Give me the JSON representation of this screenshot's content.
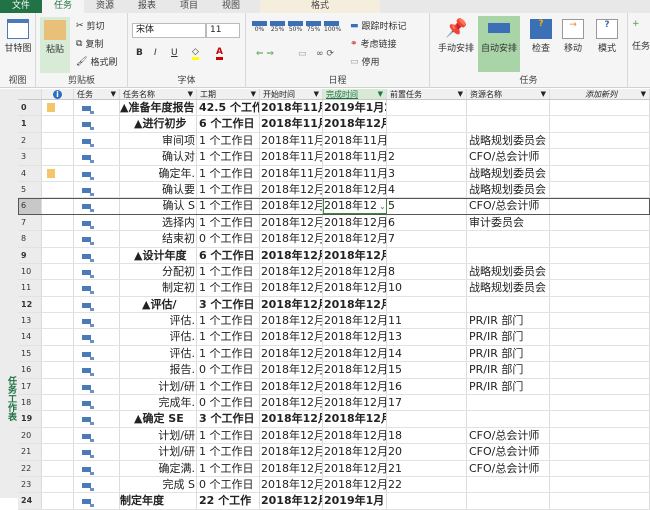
{
  "tabs": [
    "文件",
    "任务",
    "资源",
    "报表",
    "项目",
    "视图",
    "格式"
  ],
  "ribbon": {
    "view_group": {
      "gantt": "甘特图",
      "label": "视图"
    },
    "clipboard": {
      "paste": "粘贴",
      "cut": "剪切",
      "copy": "复制",
      "format_painter": "格式刷",
      "label": "剪贴板"
    },
    "font": {
      "name": "宋体",
      "size": "11",
      "bold": "B",
      "italic": "I",
      "underline": "U",
      "label": "字体"
    },
    "schedule": {
      "pcts": [
        "0%",
        "25%",
        "50%",
        "75%",
        "100%"
      ],
      "mark_on_track": "跟踪时标记",
      "respect_links": "考虑链接",
      "inactivate": "停用",
      "label": "日程"
    },
    "tasks": {
      "manual": "手动安排",
      "auto": "自动安排",
      "inspect": "检查",
      "move": "移动",
      "mode": "模式",
      "task": "任务",
      "label": "任务"
    }
  },
  "sidebar_label": "任务工作表",
  "columns": [
    "任务",
    "任务名称",
    "工期",
    "开始时间",
    "完成时间",
    "前置任务",
    "资源名称",
    "添加新列"
  ],
  "rows": [
    {
      "id": "0",
      "note": true,
      "name": "▲准备年度报告",
      "summary": true,
      "lvl": 0,
      "dur": "42.5 个工作",
      "start": "2018年11月",
      "finish": "2019年1月2",
      "pred": "",
      "res": ""
    },
    {
      "id": "1",
      "name": "▲进行初步",
      "summary": true,
      "lvl": 1,
      "dur": "6 个工作日",
      "start": "2018年11月",
      "finish": "2018年12月",
      "pred": "",
      "res": ""
    },
    {
      "id": "2",
      "name": "审间项",
      "dur": "1 个工作日",
      "start": "2018年11月",
      "finish": "2018年11月",
      "pred": "",
      "res": "战略规划委员会"
    },
    {
      "id": "3",
      "name": "确认对",
      "dur": "1 个工作日",
      "start": "2018年11月",
      "finish": "2018年11月",
      "pred": "2",
      "res": "CFO/总会计师"
    },
    {
      "id": "4",
      "note": true,
      "name": "确定年.",
      "dur": "1 个工作日",
      "start": "2018年11月",
      "finish": "2018年11月",
      "pred": "3",
      "res": "战略规划委员会"
    },
    {
      "id": "5",
      "name": "确认要",
      "dur": "1 个工作日",
      "start": "2018年12月",
      "finish": "2018年12月",
      "pred": "4",
      "res": "战略规划委员会"
    },
    {
      "id": "6",
      "name": "确认 S",
      "dur": "1 个工作日",
      "start": "2018年12月",
      "finish": "2018年12",
      "pred": "5",
      "res": "CFO/总会计师",
      "selected": true
    },
    {
      "id": "7",
      "name": "选择内",
      "dur": "1 个工作日",
      "start": "2018年12月",
      "finish": "2018年12月",
      "pred": "6",
      "res": "审计委员会"
    },
    {
      "id": "8",
      "name": "结束初",
      "dur": "0 个工作日",
      "start": "2018年12月",
      "finish": "2018年12月",
      "pred": "7",
      "res": ""
    },
    {
      "id": "9",
      "name": "▲设计年度",
      "summary": true,
      "lvl": 1,
      "dur": "6 个工作日",
      "start": "2018年12月",
      "finish": "2018年12月",
      "pred": "",
      "res": ""
    },
    {
      "id": "10",
      "name": "分配初",
      "dur": "1 个工作日",
      "start": "2018年12月",
      "finish": "2018年12月",
      "pred": "8",
      "res": "战略规划委员会"
    },
    {
      "id": "11",
      "name": "制定初",
      "dur": "1 个工作日",
      "start": "2018年12月",
      "finish": "2018年12月",
      "pred": "10",
      "res": "战略规划委员会"
    },
    {
      "id": "12",
      "name": "▲评估/",
      "summary": true,
      "lvl": 2,
      "dur": "3 个工作日",
      "start": "2018年12月",
      "finish": "2018年12月",
      "pred": "",
      "res": ""
    },
    {
      "id": "13",
      "name": "评估.",
      "dur": "1 个工作日",
      "start": "2018年12月",
      "finish": "2018年12月",
      "pred": "11",
      "res": "PR/IR 部门"
    },
    {
      "id": "14",
      "name": "评估.",
      "dur": "1 个工作日",
      "start": "2018年12月",
      "finish": "2018年12月",
      "pred": "13",
      "res": "PR/IR 部门"
    },
    {
      "id": "15",
      "name": "评估.",
      "dur": "1 个工作日",
      "start": "2018年12月",
      "finish": "2018年12月",
      "pred": "14",
      "res": "PR/IR 部门"
    },
    {
      "id": "16",
      "name": "报告.",
      "dur": "0 个工作日",
      "start": "2018年12月",
      "finish": "2018年12月",
      "pred": "15",
      "res": "PR/IR 部门"
    },
    {
      "id": "17",
      "name": "计划/研",
      "dur": "1 个工作日",
      "start": "2018年12月",
      "finish": "2018年12月",
      "pred": "16",
      "res": "PR/IR 部门"
    },
    {
      "id": "18",
      "name": "完成年.",
      "dur": "0 个工作日",
      "start": "2018年12月",
      "finish": "2018年12月",
      "pred": "17",
      "res": ""
    },
    {
      "id": "19",
      "name": "▲确定 SE",
      "summary": true,
      "lvl": 1,
      "dur": "3 个工作日",
      "start": "2018年12月",
      "finish": "2018年12月",
      "pred": "",
      "res": ""
    },
    {
      "id": "20",
      "name": "计划/研",
      "dur": "1 个工作日",
      "start": "2018年12月",
      "finish": "2018年12月",
      "pred": "18",
      "res": "CFO/总会计师"
    },
    {
      "id": "21",
      "name": "计划/研",
      "dur": "1 个工作日",
      "start": "2018年12月",
      "finish": "2018年12月",
      "pred": "20",
      "res": "CFO/总会计师"
    },
    {
      "id": "22",
      "name": "确定满.",
      "dur": "1 个工作日",
      "start": "2018年12月",
      "finish": "2018年12月",
      "pred": "21",
      "res": "CFO/总会计师"
    },
    {
      "id": "23",
      "name": "完成 S",
      "dur": "0 个工作日",
      "start": "2018年12月",
      "finish": "2018年12月",
      "pred": "22",
      "res": ""
    },
    {
      "id": "24",
      "name": "制定年度",
      "summary": true,
      "lvl": 0,
      "dur": "22 个工作",
      "start": "2018年12月",
      "finish": "2019年1月",
      "pred": "",
      "res": ""
    }
  ]
}
